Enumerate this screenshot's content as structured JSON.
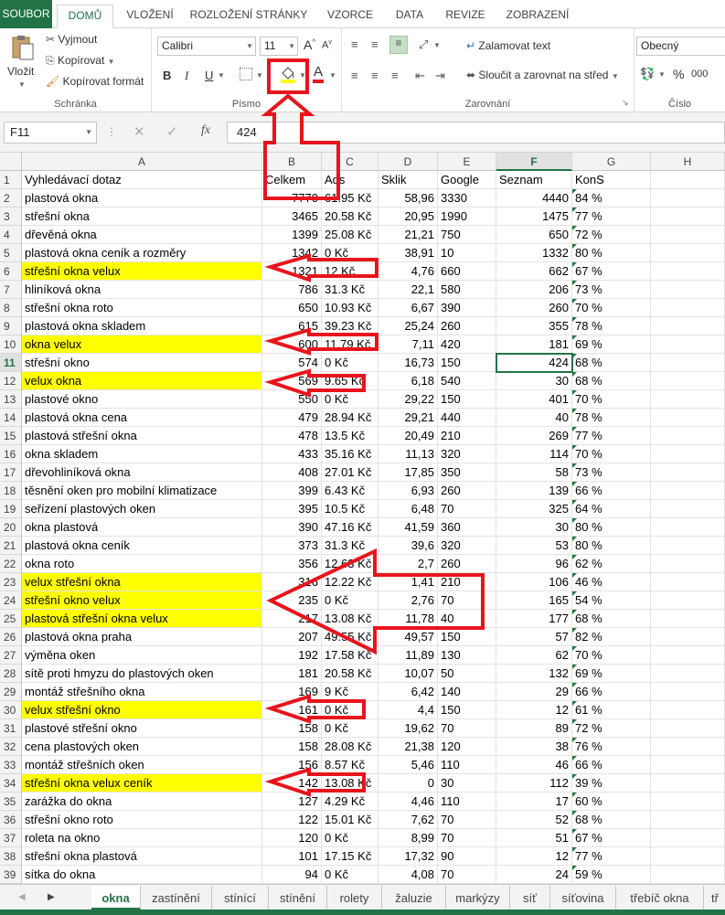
{
  "ribbon_tabs": [
    "SOUBOR",
    "DOMŮ",
    "VLOŽENÍ",
    "ROZLOŽENÍ STRÁNKY",
    "VZORCE",
    "DATA",
    "REVIZE",
    "ZOBRAZENÍ"
  ],
  "clipboard": {
    "paste": "Vložit",
    "cut": "Vyjmout",
    "copy": "Kopírovat",
    "format_painter": "Kopírovat formát",
    "label": "Schránka"
  },
  "font": {
    "name": "Calibri",
    "size": "11",
    "label": "Písmo",
    "bold": "B",
    "italic": "I",
    "underline": "U",
    "grow": "A",
    "shrink": "A",
    "color_letter": "A"
  },
  "alignment": {
    "wrap": "Zalamovat text",
    "merge": "Sloučit a zarovnat na střed",
    "label": "Zarovnání"
  },
  "number": {
    "format": "Obecný",
    "label": "Číslo",
    "percent": "%",
    "comma": "000"
  },
  "formula_bar": {
    "name_box": "F11",
    "fx": "fx",
    "value": "424"
  },
  "columns": [
    "A",
    "B",
    "C",
    "D",
    "E",
    "F",
    "G",
    "H"
  ],
  "rows": [
    {
      "n": "1",
      "a": "Vyhledávací dotaz",
      "b": "Celkem",
      "c": "Ads",
      "d": "Sklik",
      "e": "Google",
      "f": "Seznam",
      "g": "KonS",
      "hl": false,
      "header": true
    },
    {
      "n": "2",
      "a": "plastová okna",
      "b": "7770",
      "c": "61.95 Kč",
      "d": "58,96",
      "e": "3330",
      "f": "4440",
      "g": "84 %",
      "hl": false
    },
    {
      "n": "3",
      "a": "střešní okna",
      "b": "3465",
      "c": "20.58 Kč",
      "d": "20,95",
      "e": "1990",
      "f": "1475",
      "g": "77 %",
      "hl": false
    },
    {
      "n": "4",
      "a": "dřevěná okna",
      "b": "1399",
      "c": "25.08 Kč",
      "d": "21,21",
      "e": "750",
      "f": "650",
      "g": "72 %",
      "hl": false
    },
    {
      "n": "5",
      "a": "plastová okna ceník a rozměry",
      "b": "1342",
      "c": "0 Kč",
      "d": "38,91",
      "e": "10",
      "f": "1332",
      "g": "80 %",
      "hl": false
    },
    {
      "n": "6",
      "a": "střešní okna velux",
      "b": "1321",
      "c": "12 Kč",
      "d": "4,76",
      "e": "660",
      "f": "662",
      "g": "67 %",
      "hl": true
    },
    {
      "n": "7",
      "a": "hliníková okna",
      "b": "786",
      "c": "31.3 Kč",
      "d": "22,1",
      "e": "580",
      "f": "206",
      "g": "73 %",
      "hl": false
    },
    {
      "n": "8",
      "a": "střešní okna roto",
      "b": "650",
      "c": "10.93 Kč",
      "d": "6,67",
      "e": "390",
      "f": "260",
      "g": "70 %",
      "hl": false
    },
    {
      "n": "9",
      "a": "plastová okna skladem",
      "b": "615",
      "c": "39.23 Kč",
      "d": "25,24",
      "e": "260",
      "f": "355",
      "g": "78 %",
      "hl": false
    },
    {
      "n": "10",
      "a": "okna velux",
      "b": "600",
      "c": "11.79 Kč",
      "d": "7,11",
      "e": "420",
      "f": "181",
      "g": "69 %",
      "hl": true
    },
    {
      "n": "11",
      "a": "střešní okno",
      "b": "574",
      "c": "0 Kč",
      "d": "16,73",
      "e": "150",
      "f": "424",
      "g": "68 %",
      "hl": false
    },
    {
      "n": "12",
      "a": "velux okna",
      "b": "569",
      "c": "9.65 Kč",
      "d": "6,18",
      "e": "540",
      "f": "30",
      "g": "68 %",
      "hl": true
    },
    {
      "n": "13",
      "a": "plastové okno",
      "b": "550",
      "c": "0 Kč",
      "d": "29,22",
      "e": "150",
      "f": "401",
      "g": "70 %",
      "hl": false
    },
    {
      "n": "14",
      "a": "plastová okna cena",
      "b": "479",
      "c": "28.94 Kč",
      "d": "29,21",
      "e": "440",
      "f": "40",
      "g": "78 %",
      "hl": false
    },
    {
      "n": "15",
      "a": "plastová střešní okna",
      "b": "478",
      "c": "13.5 Kč",
      "d": "20,49",
      "e": "210",
      "f": "269",
      "g": "77 %",
      "hl": false
    },
    {
      "n": "16",
      "a": "okna skladem",
      "b": "433",
      "c": "35.16 Kč",
      "d": "11,13",
      "e": "320",
      "f": "114",
      "g": "70 %",
      "hl": false
    },
    {
      "n": "17",
      "a": "dřevohliníková okna",
      "b": "408",
      "c": "27.01 Kč",
      "d": "17,85",
      "e": "350",
      "f": "58",
      "g": "73 %",
      "hl": false
    },
    {
      "n": "18",
      "a": "těsnění oken pro mobilní klimatizace",
      "b": "399",
      "c": "6.43 Kč",
      "d": "6,93",
      "e": "260",
      "f": "139",
      "g": "66 %",
      "hl": false
    },
    {
      "n": "19",
      "a": "seřízení plastových oken",
      "b": "395",
      "c": "10.5 Kč",
      "d": "6,48",
      "e": "70",
      "f": "325",
      "g": "64 %",
      "hl": false
    },
    {
      "n": "20",
      "a": "okna plastová",
      "b": "390",
      "c": "47.16 Kč",
      "d": "41,59",
      "e": "360",
      "f": "30",
      "g": "80 %",
      "hl": false
    },
    {
      "n": "21",
      "a": "plastová okna ceník",
      "b": "373",
      "c": "31.3 Kč",
      "d": "39,6",
      "e": "320",
      "f": "53",
      "g": "80 %",
      "hl": false
    },
    {
      "n": "22",
      "a": "okna roto",
      "b": "356",
      "c": "12.63 Kč",
      "d": "2,7",
      "e": "260",
      "f": "96",
      "g": "62 %",
      "hl": false
    },
    {
      "n": "23",
      "a": "velux střešní okna",
      "b": "316",
      "c": "12.22 Kč",
      "d": "1,41",
      "e": "210",
      "f": "106",
      "g": "46 %",
      "hl": true
    },
    {
      "n": "24",
      "a": "střešní okno velux",
      "b": "235",
      "c": "0 Kč",
      "d": "2,76",
      "e": "70",
      "f": "165",
      "g": "54 %",
      "hl": true
    },
    {
      "n": "25",
      "a": "plastová střešní okna velux",
      "b": "217",
      "c": "13.08 Kč",
      "d": "11,78",
      "e": "40",
      "f": "177",
      "g": "68 %",
      "hl": true
    },
    {
      "n": "26",
      "a": "plastová okna praha",
      "b": "207",
      "c": "49.55 Kč",
      "d": "49,57",
      "e": "150",
      "f": "57",
      "g": "82 %",
      "hl": false
    },
    {
      "n": "27",
      "a": "výměna oken",
      "b": "192",
      "c": "17.58 Kč",
      "d": "11,89",
      "e": "130",
      "f": "62",
      "g": "70 %",
      "hl": false
    },
    {
      "n": "28",
      "a": "sítě proti hmyzu do plastových oken",
      "b": "181",
      "c": "20.58 Kč",
      "d": "10,07",
      "e": "50",
      "f": "132",
      "g": "69 %",
      "hl": false
    },
    {
      "n": "29",
      "a": "montáž střešního okna",
      "b": "169",
      "c": "9 Kč",
      "d": "6,42",
      "e": "140",
      "f": "29",
      "g": "66 %",
      "hl": false
    },
    {
      "n": "30",
      "a": "velux střešní okno",
      "b": "161",
      "c": "0 Kč",
      "d": "4,4",
      "e": "150",
      "f": "12",
      "g": "61 %",
      "hl": true
    },
    {
      "n": "31",
      "a": "plastové střešní okno",
      "b": "158",
      "c": "0 Kč",
      "d": "19,62",
      "e": "70",
      "f": "89",
      "g": "72 %",
      "hl": false
    },
    {
      "n": "32",
      "a": "cena plastových oken",
      "b": "158",
      "c": "28.08 Kč",
      "d": "21,38",
      "e": "120",
      "f": "38",
      "g": "76 %",
      "hl": false
    },
    {
      "n": "33",
      "a": "montáž střešních oken",
      "b": "156",
      "c": "8.57 Kč",
      "d": "5,46",
      "e": "110",
      "f": "46",
      "g": "66 %",
      "hl": false
    },
    {
      "n": "34",
      "a": "střešní okna velux ceník",
      "b": "142",
      "c": "13.08 Kč",
      "d": "0",
      "e": "30",
      "f": "112",
      "g": "39 %",
      "hl": true
    },
    {
      "n": "35",
      "a": "zarážka do okna",
      "b": "127",
      "c": "4.29 Kč",
      "d": "4,46",
      "e": "110",
      "f": "17",
      "g": "60 %",
      "hl": false
    },
    {
      "n": "36",
      "a": "střešní okno roto",
      "b": "122",
      "c": "15.01 Kč",
      "d": "7,62",
      "e": "70",
      "f": "52",
      "g": "68 %",
      "hl": false
    },
    {
      "n": "37",
      "a": "roleta na okno",
      "b": "120",
      "c": "0 Kč",
      "d": "8,99",
      "e": "70",
      "f": "51",
      "g": "67 %",
      "hl": false
    },
    {
      "n": "38",
      "a": "střešní okna plastová",
      "b": "101",
      "c": "17.15 Kč",
      "d": "17,32",
      "e": "90",
      "f": "12",
      "g": "77 %",
      "hl": false
    },
    {
      "n": "39",
      "a": "sítka do okna",
      "b": "94",
      "c": "0 Kč",
      "d": "4,08",
      "e": "70",
      "f": "24",
      "g": "59 %",
      "hl": false
    }
  ],
  "sheet_tabs": [
    "okna",
    "zastínění",
    "stínící",
    "stínění",
    "rolety",
    "žaluzie",
    "markýzy",
    "síť",
    "síťovina",
    "třebíč okna",
    "tř"
  ],
  "annotation_color": "#e8141c",
  "highlight_color": "#ffff00",
  "accent_color": "#217346"
}
